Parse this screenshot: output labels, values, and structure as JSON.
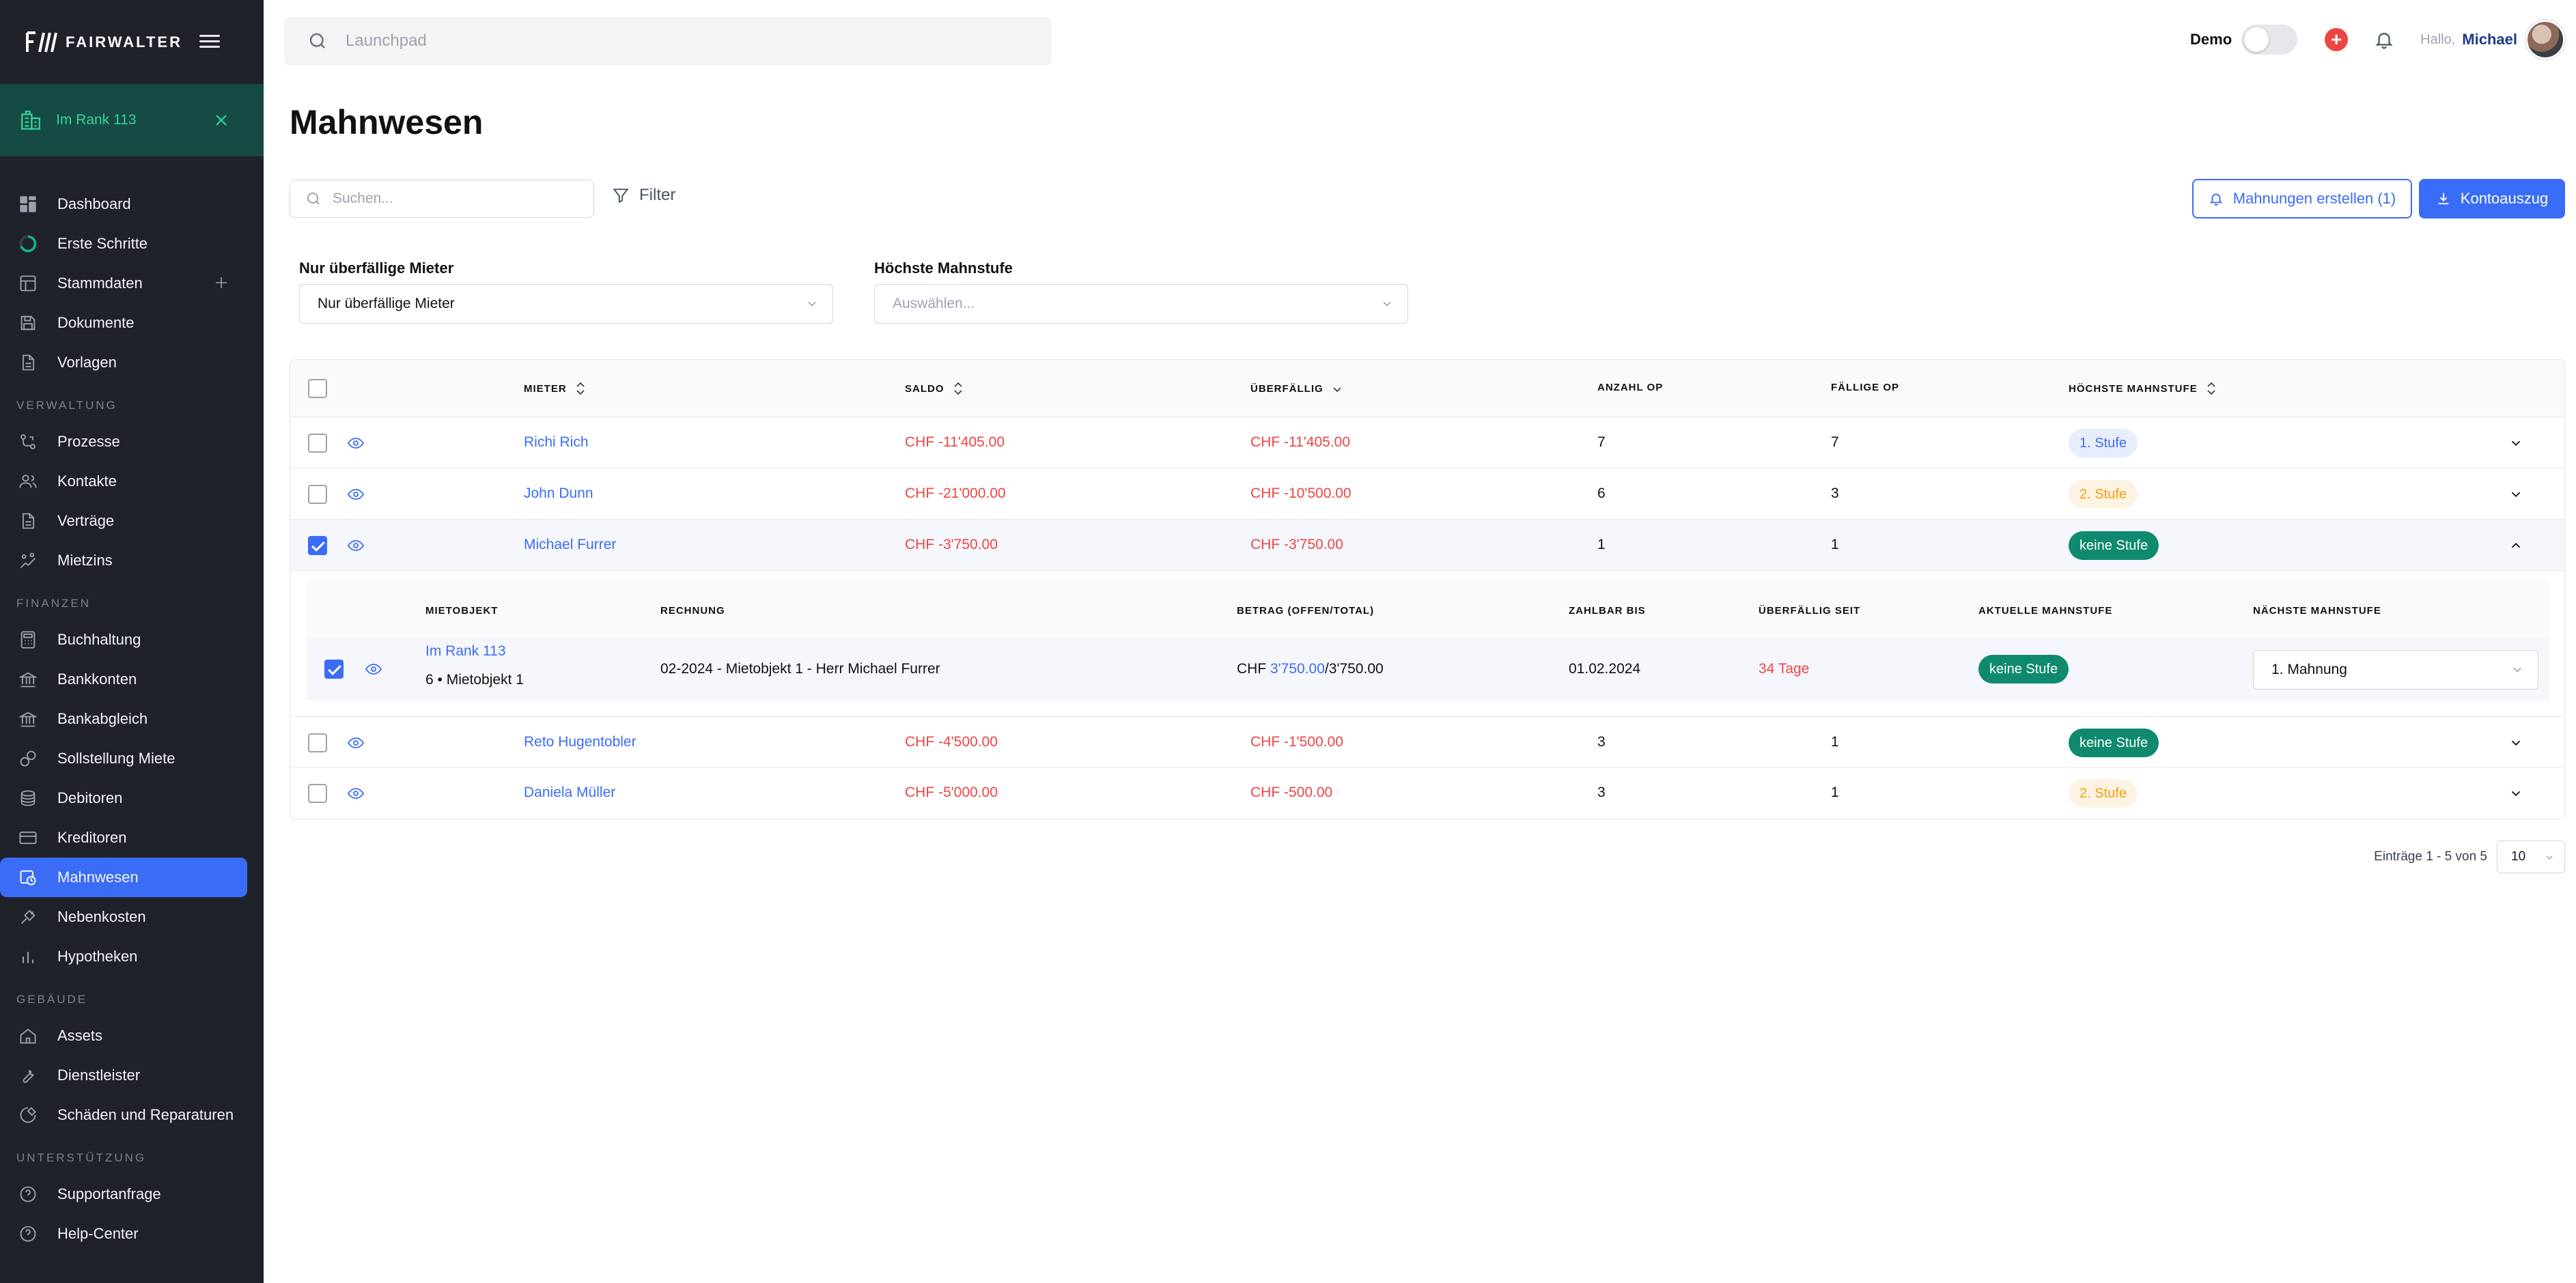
{
  "brand": {
    "mark": "F/\\\\",
    "name": "FAIRWALTER"
  },
  "property": {
    "label": "Im Rank 113"
  },
  "nav": {
    "items_top": [
      {
        "label": "Dashboard",
        "icon": "grid-icon"
      },
      {
        "label": "Erste Schritte",
        "icon": "progress-circle-icon"
      },
      {
        "label": "Stammdaten",
        "icon": "table-layout-icon"
      },
      {
        "label": "Dokumente",
        "icon": "save-icon"
      },
      {
        "label": "Vorlagen",
        "icon": "document-icon"
      }
    ],
    "section_verwaltung": "VERWALTUNG",
    "items_verwaltung": [
      {
        "label": "Prozesse",
        "icon": "process-icon"
      },
      {
        "label": "Kontakte",
        "icon": "contacts-icon"
      },
      {
        "label": "Verträge",
        "icon": "document-icon"
      },
      {
        "label": "Mietzins",
        "icon": "rent-icon"
      }
    ],
    "section_finanzen": "FINANZEN",
    "items_finanzen": [
      {
        "label": "Buchhaltung",
        "icon": "calculator-icon"
      },
      {
        "label": "Bankkonten",
        "icon": "bank-icon"
      },
      {
        "label": "Bankabgleich",
        "icon": "bank-icon"
      },
      {
        "label": "Sollstellung Miete",
        "icon": "coins-icon"
      },
      {
        "label": "Debitoren",
        "icon": "stack-icon"
      },
      {
        "label": "Kreditoren",
        "icon": "credit-card-icon"
      },
      {
        "label": "Mahnwesen",
        "icon": "reminder-icon"
      },
      {
        "label": "Nebenkosten",
        "icon": "utility-icon"
      },
      {
        "label": "Hypotheken",
        "icon": "bar-chart-icon"
      }
    ],
    "section_gebaeude": "GEBÄUDE",
    "items_gebaeude": [
      {
        "label": "Assets",
        "icon": "home-icon"
      },
      {
        "label": "Dienstleister",
        "icon": "wrench-icon"
      },
      {
        "label": "Schäden und Reparaturen",
        "icon": "repair-icon"
      }
    ],
    "section_unterstuetzung": "UNTERSTÜTZUNG",
    "items_unterstuetzung": [
      {
        "label": "Supportanfrage",
        "icon": "help-icon"
      },
      {
        "label": "Help-Center",
        "icon": "help-icon"
      }
    ]
  },
  "topbar": {
    "search_placeholder": "Launchpad",
    "demo_label": "Demo",
    "greeting": "Hallo,",
    "user_name": "Michael"
  },
  "page": {
    "title": "Mahnwesen",
    "search_placeholder": "Suchen...",
    "filter_label": "Filter",
    "btn_create": "Mahnungen erstellen (1)",
    "btn_statement": "Kontoauszug",
    "filter1_label": "Nur überfällige Mieter",
    "filter1_value": "Nur überfällige Mieter",
    "filter2_label": "Höchste Mahnstufe",
    "filter2_placeholder": "Auswählen..."
  },
  "table": {
    "headers": {
      "mieter": "MIETER",
      "saldo": "SALDO",
      "ueberfaellig": "ÜBERFÄLLIG",
      "anzahl_op": "ANZAHL OP",
      "faellige_op": "FÄLLIGE OP",
      "hoechste": "HÖCHSTE MAHNSTUFE"
    },
    "rows": [
      {
        "mieter": "Richi Rich",
        "saldo": "CHF -11'405.00",
        "ueberfaellig": "CHF -11'405.00",
        "anzahl": "7",
        "faellig": "7",
        "stufe": "1. Stufe"
      },
      {
        "mieter": "John Dunn",
        "saldo": "CHF -21'000.00",
        "ueberfaellig": "CHF -10'500.00",
        "anzahl": "6",
        "faellig": "3",
        "stufe": "2. Stufe"
      },
      {
        "mieter": "Michael Furrer",
        "saldo": "CHF -3'750.00",
        "ueberfaellig": "CHF -3'750.00",
        "anzahl": "1",
        "faellig": "1",
        "stufe": "keine Stufe"
      },
      {
        "mieter": "Reto Hugentobler",
        "saldo": "CHF -4'500.00",
        "ueberfaellig": "CHF -1'500.00",
        "anzahl": "3",
        "faellig": "1",
        "stufe": "keine Stufe"
      },
      {
        "mieter": "Daniela Müller",
        "saldo": "CHF -5'000.00",
        "ueberfaellig": "CHF -500.00",
        "anzahl": "3",
        "faellig": "1",
        "stufe": "2. Stufe"
      }
    ],
    "detail": {
      "headers": {
        "mietobjekt": "MIETOBJEKT",
        "rechnung": "RECHNUNG",
        "betrag": "BETRAG (OFFEN/TOTAL)",
        "zahlbar": "ZAHLBAR BIS",
        "ueberfaellig_seit": "ÜBERFÄLLIG SEIT",
        "aktuelle": "AKTUELLE MAHNSTUFE",
        "naechste": "NÄCHSTE MAHNSTUFE"
      },
      "row": {
        "objekt": "Im Rank 113",
        "objekt_sub": "6 • Mietobjekt 1",
        "rechnung": "02-2024 - Mietobjekt 1 - Herr Michael Furrer",
        "betrag_prefix": "CHF ",
        "betrag_offen": "3'750.00",
        "betrag_total": "/3'750.00",
        "zahlbar": "01.02.2024",
        "ueberfaellig_seit": "34 Tage",
        "aktuelle": "keine Stufe",
        "naechste": "1. Mahnung"
      }
    }
  },
  "pager": {
    "text": "Einträge 1 - 5 von 5",
    "page_size": "10"
  }
}
